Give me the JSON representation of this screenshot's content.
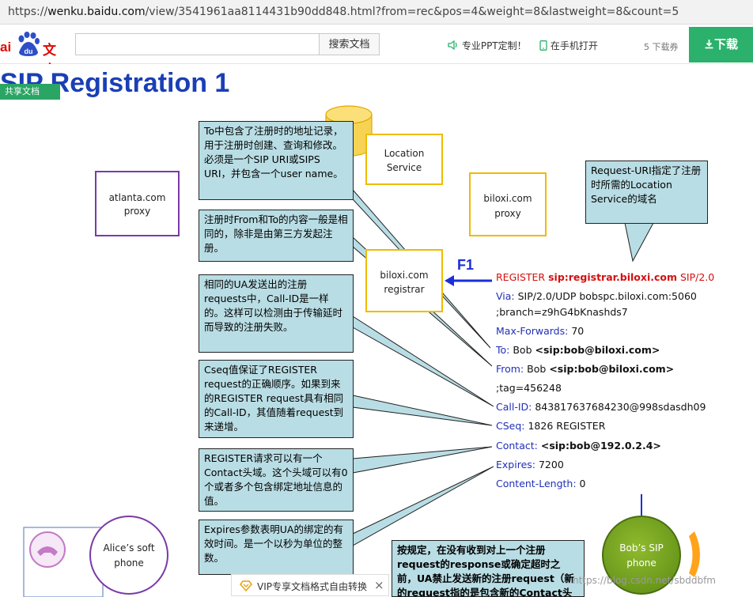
{
  "browser": {
    "url_prefix": "https://",
    "url_domain": "wenku.baidu.com",
    "url_path": "/view/3541961aa8114431b90dd848.html?from=rec&pos=4&weight=8&lastweight=8&count=5"
  },
  "header": {
    "logo_bai": "ai",
    "logo_du": "du",
    "logo_wenku": "文库",
    "search_placeholder": "",
    "search_button": "搜索文档",
    "ppt_label": "专业PPT定制！",
    "phone_label": "在手机打开",
    "coupon_label": "5 下载券",
    "download_label": "下载"
  },
  "slide": {
    "title": "SIP  Registration 1",
    "share_badge": "共享文档",
    "nodes": {
      "atlanta_proxy": "atlanta.com proxy",
      "location_service": "Location Service",
      "biloxi_proxy": "biloxi.com proxy",
      "biloxi_registrar": "biloxi.com registrar",
      "alice": "Alice’s soft phone",
      "bob": "Bob’s SIP phone"
    },
    "f1_label": "F1",
    "callouts": [
      "To中包含了注册时的地址记录，用于注册时创建、查询和修改。必须是一个SIP URI或SIPS URI，并包含一个user name。",
      "注册时From和To的内容一般是相同的，除非是由第三方发起注册。",
      "相同的UA发送出的注册requests中，Call-ID是一样的。这样可以检测由于传输延时而导致的注册失败。",
      "Cseq值保证了REGISTER request的正确顺序。如果到来的REGISTER request具有相同的Call-ID，其值随着request到来递增。",
      "REGISTER请求可以有一个Contact头域。这个头域可以有0个或者多个包含绑定地址信息的值。",
      "Expires参数表明UA的绑定的有效时间。是一个以秒为单位的整数。",
      "Request-URI指定了注册时所需的Location Service的域名",
      "按规定，在没有收到对上一个注册request的response或确定超时之前，UA禁止发送新的注册request（新的request指的是包含新的Contact头"
    ],
    "sip_lines": {
      "register_method": "REGISTER",
      "register_uri": "sip:registrar.biloxi.com",
      "register_version": "SIP/2.0",
      "via_key": "Via:",
      "via_val": "SIP/2.0/UDP bobspc.biloxi.com:5060",
      "via_branch": ";branch=z9hG4bKnashds7",
      "maxfwd_key": "Max-Forwards:",
      "maxfwd_val": "70",
      "to_key": "To:",
      "to_name": "Bob",
      "to_uri": "<sip:bob@biloxi.com>",
      "from_key": "From:",
      "from_name": "Bob",
      "from_uri": "<sip:bob@biloxi.com>",
      "from_tag": ";tag=456248",
      "callid_key": "Call-ID:",
      "callid_val": "843817637684230@998sdasdh09",
      "cseq_key": "CSeq:",
      "cseq_val": "1826 REGISTER",
      "contact_key": "Contact:",
      "contact_val": "<sip:bob@192.0.2.4>",
      "expires_key": "Expires:",
      "expires_val": "7200",
      "clen_key": "Content-Length:",
      "clen_val": "0"
    }
  },
  "vip_bar": {
    "label": "VIP专享文档格式自由转换",
    "close": "×"
  },
  "watermark": "https://blog.csdn.net/sbddbfm",
  "colors": {
    "brand_red": "#e10601",
    "download_green": "#2bb16b",
    "title_blue": "#1a3fb5",
    "callout_fill": "#b9dde4",
    "header_key_blue": "#2130b8",
    "bob_phone_green": "#6a9a1f"
  }
}
